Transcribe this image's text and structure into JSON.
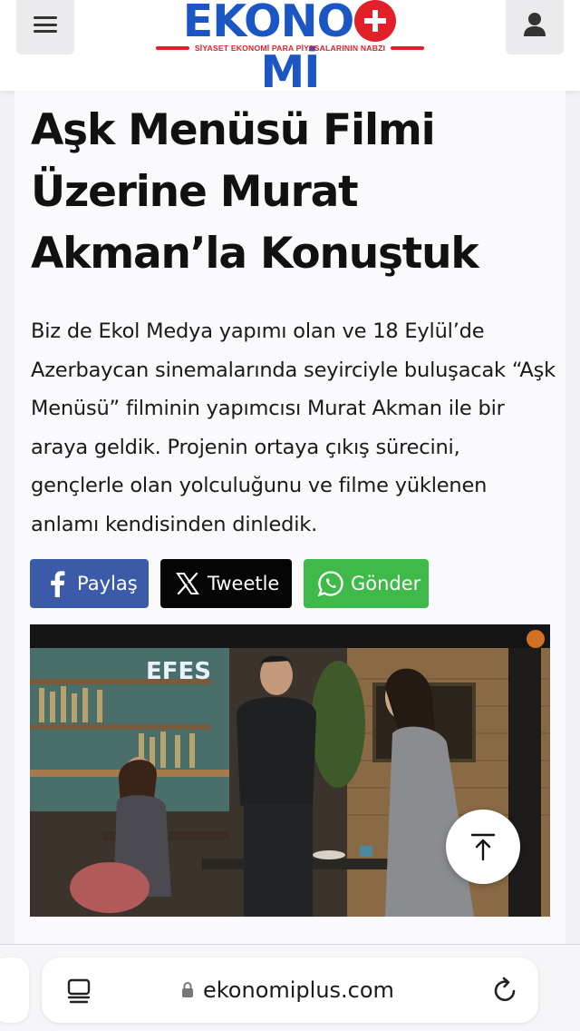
{
  "header": {
    "logo_text_before": "EKONO",
    "logo_text_after": "Mİ",
    "logo_tagline": "SİYASET EKONOMİ PARA PİYASALARININ NABZI",
    "menu_icon": "hamburger-menu-icon",
    "user_icon": "user-icon"
  },
  "article": {
    "title": "Aşk Menüsü Filmi Üzerine Murat Akman’la Konuştuk",
    "lead": "Biz de Ekol Medya yapımı olan ve 18 Eylül’de Azerbaycan sinemalarında seyirciyle buluşacak “Aşk Menüsü” filminin yapımcısı Murat Akman ile bir araya geldik. Projenin ortaya çıkış sürecini, gençlerle olan yolculuğunu ve filme yüklenen anlamı kendisinden dinledik.",
    "share": {
      "facebook_label": "Paylaş",
      "x_label": "Tweetle",
      "whatsapp_label": "Gönder"
    },
    "image_sign_text": "EFES"
  },
  "browser": {
    "url": "ekonomiplus.com",
    "reader_icon": "reader-mode-icon",
    "lock_icon": "lock-icon",
    "reload_icon": "reload-icon"
  },
  "colors": {
    "brand_blue": "#1a56c4",
    "brand_red": "#e22028",
    "facebook": "#3b5ba8",
    "x": "#050505",
    "whatsapp": "#3fb94a"
  }
}
